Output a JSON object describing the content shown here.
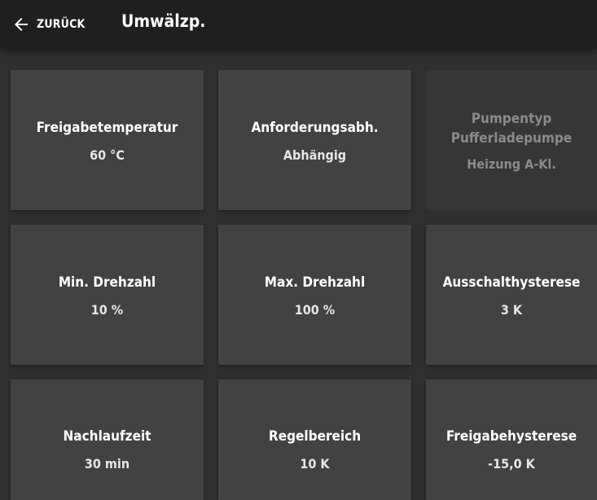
{
  "header": {
    "back_label": "ZURÜCK",
    "title": "Umwälzp."
  },
  "tiles": [
    {
      "label": "Freigabetemperatur",
      "value": "60 °C"
    },
    {
      "label": "Anforderungsabh.",
      "value": "Abhängig"
    },
    {
      "label_line1": "Pumpentyp",
      "label_line2": "Pufferladepumpe",
      "value": "Heizung A-Kl.",
      "enabled": false
    },
    {
      "label": "Min. Drehzahl",
      "value": "10 %"
    },
    {
      "label": "Max. Drehzahl",
      "value": "100 %"
    },
    {
      "label": "Ausschalthysterese",
      "value": "3 K"
    },
    {
      "label": "Nachlaufzeit",
      "value": "30 min"
    },
    {
      "label": "Regelbereich",
      "value": "10 K"
    },
    {
      "label": "Freigabehysterese",
      "value": "-15,0 K"
    }
  ]
}
